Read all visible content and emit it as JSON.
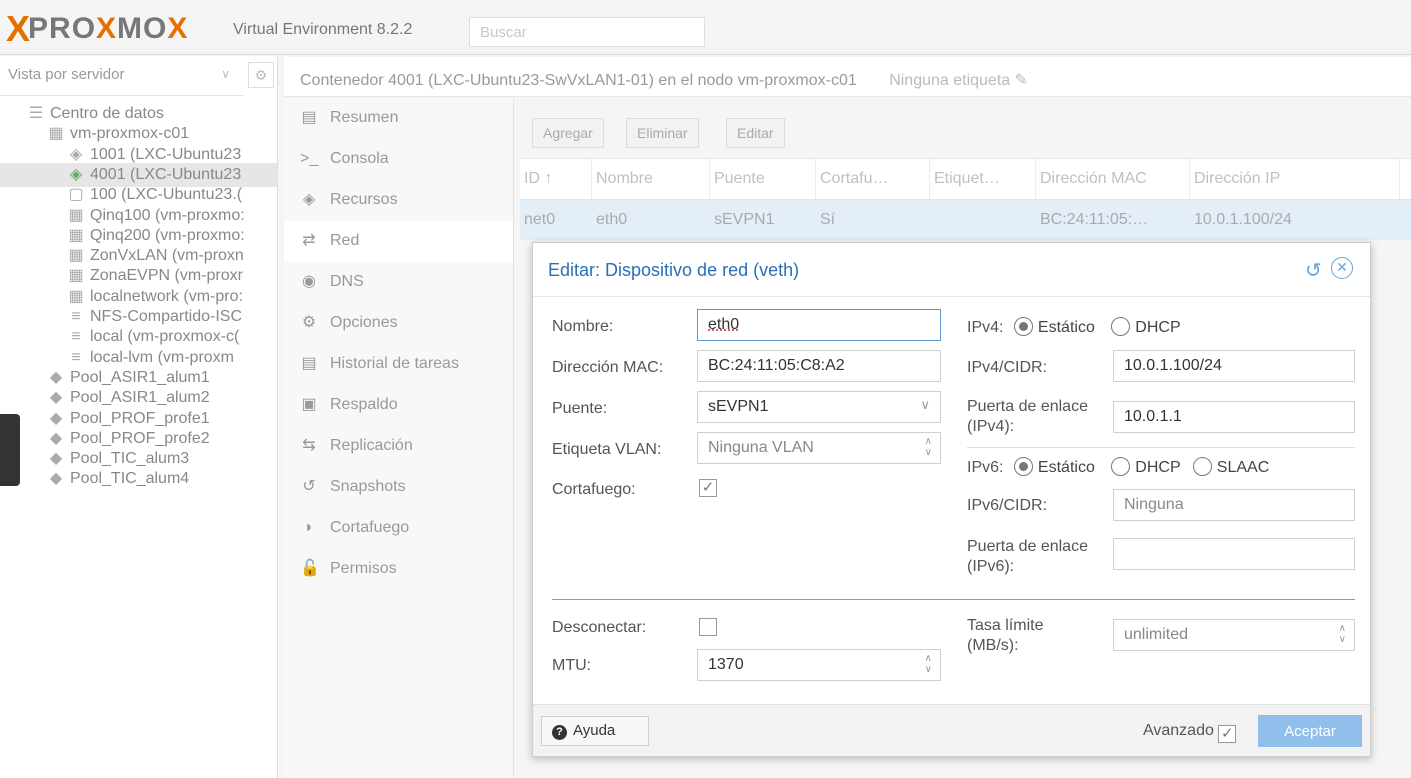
{
  "header": {
    "logo_x": "X",
    "logo_pro": "PRO",
    "logo_x2": "X",
    "logo_mo": "MO",
    "logo_x3": "X",
    "version": "Virtual Environment 8.2.2",
    "search_placeholder": "Buscar"
  },
  "tree": {
    "view_selector": "Vista por servidor",
    "items": [
      {
        "label": "Centro de datos",
        "icon": "datacenter-icon"
      },
      {
        "label": "vm-proxmox-c01",
        "icon": "node-icon"
      },
      {
        "label": "1001 (LXC-Ubuntu23",
        "icon": "container-icon"
      },
      {
        "label": "4001 (LXC-Ubuntu23",
        "icon": "container-running-icon"
      },
      {
        "label": "100 (LXC-Ubuntu23.(",
        "icon": "template-icon"
      },
      {
        "label": "Qinq100 (vm-proxmo:",
        "icon": "sdn-icon"
      },
      {
        "label": "Qinq200 (vm-proxmo:",
        "icon": "sdn-icon"
      },
      {
        "label": "ZonVxLAN (vm-proxn",
        "icon": "sdn-icon"
      },
      {
        "label": "ZonaEVPN (vm-proxr",
        "icon": "sdn-icon"
      },
      {
        "label": "localnetwork (vm-pro:",
        "icon": "sdn-icon"
      },
      {
        "label": "NFS-Compartido-ISC",
        "icon": "storage-icon"
      },
      {
        "label": "local (vm-proxmox-c(",
        "icon": "storage-icon"
      },
      {
        "label": "local-lvm (vm-proxm",
        "icon": "storage-icon"
      },
      {
        "label": "Pool_ASIR1_alum1",
        "icon": "pool-icon"
      },
      {
        "label": "Pool_ASIR1_alum2",
        "icon": "pool-icon"
      },
      {
        "label": "Pool_PROF_profe1",
        "icon": "pool-icon"
      },
      {
        "label": "Pool_PROF_profe2",
        "icon": "pool-icon"
      },
      {
        "label": "Pool_TIC_alum3",
        "icon": "pool-icon"
      },
      {
        "label": "Pool_TIC_alum4",
        "icon": "pool-icon"
      }
    ]
  },
  "content": {
    "title": "Contenedor 4001 (LXC-Ubuntu23-SwVxLAN1-01) en el nodo vm-proxmox-c01",
    "tag_label": "Ninguna etiqueta"
  },
  "nav": {
    "items": [
      {
        "label": "Resumen",
        "icon": "summary-icon"
      },
      {
        "label": "Consola",
        "icon": "console-icon"
      },
      {
        "label": "Recursos",
        "icon": "resources-icon"
      },
      {
        "label": "Red",
        "icon": "network-icon"
      },
      {
        "label": "DNS",
        "icon": "dns-icon"
      },
      {
        "label": "Opciones",
        "icon": "options-icon"
      },
      {
        "label": "Historial de tareas",
        "icon": "task-history-icon"
      },
      {
        "label": "Respaldo",
        "icon": "backup-icon"
      },
      {
        "label": "Replicación",
        "icon": "replication-icon"
      },
      {
        "label": "Snapshots",
        "icon": "snapshots-icon"
      },
      {
        "label": "Cortafuego",
        "icon": "firewall-icon"
      },
      {
        "label": "Permisos",
        "icon": "permissions-icon"
      }
    ]
  },
  "toolbar": {
    "add": "Agregar",
    "remove": "Eliminar",
    "edit": "Editar"
  },
  "grid": {
    "columns": [
      "ID ↑",
      "Nombre",
      "Puente",
      "Cortafu…",
      "Etiquet…",
      "Dirección MAC",
      "Dirección IP"
    ],
    "rows": [
      [
        "net0",
        "eth0",
        "sEVPN1",
        "Sí",
        "",
        "BC:24:11:05:…",
        "10.0.1.100/24"
      ]
    ]
  },
  "dialog": {
    "title": "Editar: Dispositivo de red (veth)",
    "name_label": "Nombre:",
    "name_value": "eth0",
    "mac_label": "Dirección MAC:",
    "mac_value": "BC:24:11:05:C8:A2",
    "bridge_label": "Puente:",
    "bridge_value": "sEVPN1",
    "vlan_label": "Etiqueta VLAN:",
    "vlan_value": "Ninguna VLAN",
    "firewall_label": "Cortafuego:",
    "firewall_checked": true,
    "ipv4_label": "IPv4:",
    "ipv4_static": "Estático",
    "ipv4_dhcp": "DHCP",
    "ipv4cidr_label": "IPv4/CIDR:",
    "ipv4cidr_value": "10.0.1.100/24",
    "gw4_label_1": "Puerta de enlace",
    "gw4_label_2": "(IPv4):",
    "gw4_value": "10.0.1.1",
    "ipv6_label": "IPv6:",
    "ipv6_static": "Estático",
    "ipv6_dhcp": "DHCP",
    "ipv6_slaac": "SLAAC",
    "ipv6cidr_label": "IPv6/CIDR:",
    "ipv6cidr_value": "Ninguna",
    "gw6_label_1": "Puerta de enlace",
    "gw6_label_2": "(IPv6):",
    "gw6_value": "",
    "disconnect_label": "Desconectar:",
    "mtu_label": "MTU:",
    "mtu_value": "1370",
    "rate_label_1": "Tasa límite",
    "rate_label_2": "(MB/s):",
    "rate_value": "unlimited",
    "help": "Ayuda",
    "advanced": "Avanzado",
    "ok": "Aceptar"
  }
}
